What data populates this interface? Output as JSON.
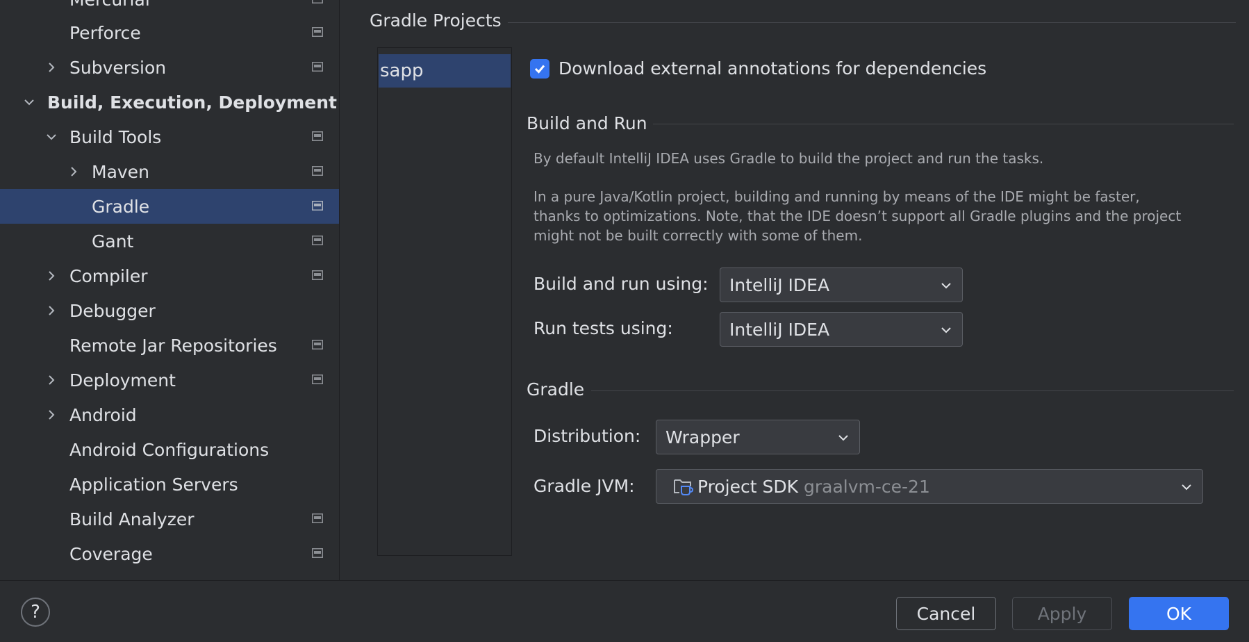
{
  "sidebar": {
    "items": [
      {
        "label": "Mercurial",
        "arrow": "none",
        "icon": true
      },
      {
        "label": "Perforce",
        "arrow": "none",
        "icon": true
      },
      {
        "label": "Subversion",
        "arrow": "right",
        "icon": true
      },
      {
        "label": "Build, Execution, Deployment",
        "arrow": "down",
        "icon": false
      },
      {
        "label": "Build Tools",
        "arrow": "down",
        "icon": true
      },
      {
        "label": "Maven",
        "arrow": "right",
        "icon": true
      },
      {
        "label": "Gradle",
        "arrow": "none",
        "icon": true,
        "selected": true
      },
      {
        "label": "Gant",
        "arrow": "none",
        "icon": true
      },
      {
        "label": "Compiler",
        "arrow": "right",
        "icon": true
      },
      {
        "label": "Debugger",
        "arrow": "right",
        "icon": false
      },
      {
        "label": "Remote Jar Repositories",
        "arrow": "none",
        "icon": true
      },
      {
        "label": "Deployment",
        "arrow": "right",
        "icon": true
      },
      {
        "label": "Android",
        "arrow": "right",
        "icon": false
      },
      {
        "label": "Android Configurations",
        "arrow": "none",
        "icon": false
      },
      {
        "label": "Application Servers",
        "arrow": "none",
        "icon": false
      },
      {
        "label": "Build Analyzer",
        "arrow": "none",
        "icon": true
      },
      {
        "label": "Coverage",
        "arrow": "none",
        "icon": true
      }
    ]
  },
  "main": {
    "projects_title": "Gradle Projects",
    "projects": [
      "sapp"
    ],
    "download_annotations": {
      "label": "Download external annotations for dependencies",
      "checked": true
    },
    "build_and_run": {
      "title": "Build and Run",
      "hint_1": "By default IntelliJ IDEA uses Gradle to build the project and run the tasks.",
      "hint_2_line1": "In a pure Java/Kotlin project, building and running by means of the IDE might be faster,",
      "hint_2_line2": "thanks to optimizations. Note, that the IDE doesn’t support all Gradle plugins and the project",
      "hint_2_line3": "might not be built correctly with some of them.",
      "build_run_label": "Build and run using:",
      "build_run_value": "IntelliJ IDEA",
      "run_tests_label": "Run tests using:",
      "run_tests_value": "IntelliJ IDEA"
    },
    "gradle": {
      "title": "Gradle",
      "distribution_label": "Distribution:",
      "distribution_value": "Wrapper",
      "jvm_label": "Gradle JVM:",
      "jvm_value": "Project SDK",
      "jvm_secondary": "graalvm-ce-21"
    }
  },
  "footer": {
    "help": "?",
    "cancel": "Cancel",
    "apply": "Apply",
    "ok": "OK"
  },
  "colors": {
    "background": "#2b2d30",
    "selection": "#2e436e",
    "accent": "#3574f0"
  }
}
